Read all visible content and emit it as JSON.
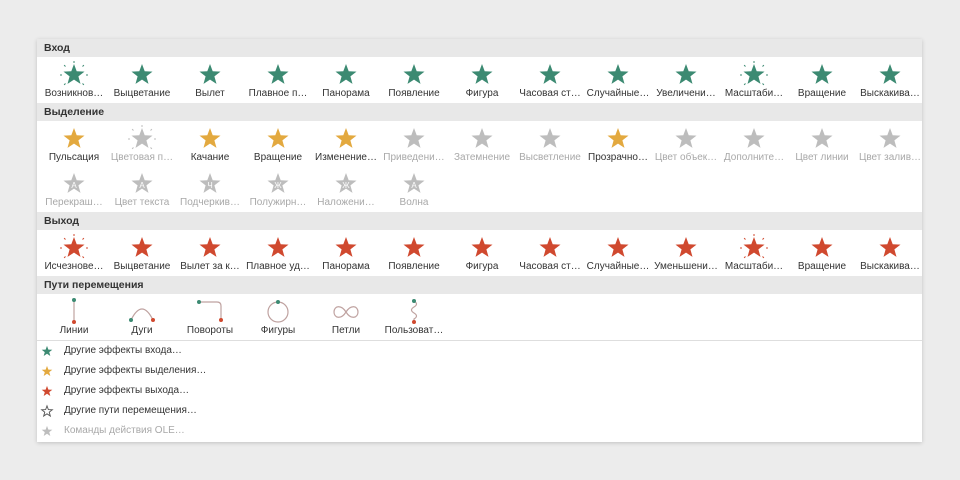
{
  "colors": {
    "entrance": "#3c8a72",
    "emphasis": "#e3a93f",
    "exit": "#d0492f",
    "disabled": "#bdbdbd",
    "path": "#bfa2a0"
  },
  "sections": {
    "entrance": {
      "title": "Вход",
      "items": [
        {
          "label": "Возникнов…",
          "icon": "appear-icon"
        },
        {
          "label": "Выцветание",
          "icon": "fade-icon"
        },
        {
          "label": "Вылет",
          "icon": "fly-in-icon"
        },
        {
          "label": "Плавное п…",
          "icon": "float-in-icon"
        },
        {
          "label": "Панорама",
          "icon": "split-icon"
        },
        {
          "label": "Появление",
          "icon": "wipe-icon"
        },
        {
          "label": "Фигура",
          "icon": "shape-icon"
        },
        {
          "label": "Часовая ст…",
          "icon": "wheel-icon"
        },
        {
          "label": "Случайные…",
          "icon": "random-bars-icon"
        },
        {
          "label": "Увеличени…",
          "icon": "grow-turn-icon"
        },
        {
          "label": "Масштаби…",
          "icon": "zoom-icon"
        },
        {
          "label": "Вращение",
          "icon": "swivel-icon"
        },
        {
          "label": "Выскакива…",
          "icon": "bounce-icon"
        }
      ]
    },
    "emphasis": {
      "title": "Выделение",
      "items": [
        {
          "label": "Пульсация",
          "icon": "pulse-icon",
          "disabled": false
        },
        {
          "label": "Цветовая п…",
          "icon": "color-pulse-icon",
          "disabled": true
        },
        {
          "label": "Качание",
          "icon": "teeter-icon",
          "disabled": false
        },
        {
          "label": "Вращение",
          "icon": "spin-icon",
          "disabled": false
        },
        {
          "label": "Изменение…",
          "icon": "grow-shrink-icon",
          "disabled": false
        },
        {
          "label": "Приведени…",
          "icon": "desaturate-icon",
          "disabled": true
        },
        {
          "label": "Затемнение",
          "icon": "darken-icon",
          "disabled": true
        },
        {
          "label": "Высветление",
          "icon": "lighten-icon",
          "disabled": true
        },
        {
          "label": "Прозрачно…",
          "icon": "transparency-icon",
          "disabled": false
        },
        {
          "label": "Цвет объек…",
          "icon": "object-color-icon",
          "disabled": true
        },
        {
          "label": "Дополните…",
          "icon": "complementary-color-icon",
          "disabled": true
        },
        {
          "label": "Цвет линии",
          "icon": "line-color-icon",
          "disabled": true
        },
        {
          "label": "Цвет залив…",
          "icon": "fill-color-icon",
          "disabled": true
        },
        {
          "label": "Перекраш…",
          "icon": "brush-color-icon",
          "disabled": true,
          "glyph": "A"
        },
        {
          "label": "Цвет текста",
          "icon": "font-color-icon",
          "disabled": true,
          "glyph": "A"
        },
        {
          "label": "Подчеркив…",
          "icon": "underline-icon",
          "disabled": true,
          "glyph": "Ч"
        },
        {
          "label": "Полужирн…",
          "icon": "bold-flash-icon",
          "disabled": true,
          "glyph": "Ж"
        },
        {
          "label": "Наложени…",
          "icon": "bold-reveal-icon",
          "disabled": true,
          "glyph": "Ж"
        },
        {
          "label": "Волна",
          "icon": "wave-icon",
          "disabled": true,
          "glyph": "A"
        }
      ]
    },
    "exit": {
      "title": "Выход",
      "items": [
        {
          "label": "Исчезнове…",
          "icon": "disappear-icon"
        },
        {
          "label": "Выцветание",
          "icon": "fade-out-icon"
        },
        {
          "label": "Вылет за к…",
          "icon": "fly-out-icon"
        },
        {
          "label": "Плавное уд…",
          "icon": "float-out-icon"
        },
        {
          "label": "Панорама",
          "icon": "split-out-icon"
        },
        {
          "label": "Появление",
          "icon": "wipe-out-icon"
        },
        {
          "label": "Фигура",
          "icon": "shape-out-icon"
        },
        {
          "label": "Часовая ст…",
          "icon": "wheel-out-icon"
        },
        {
          "label": "Случайные…",
          "icon": "random-bars-out-icon"
        },
        {
          "label": "Уменьшени…",
          "icon": "shrink-turn-icon"
        },
        {
          "label": "Масштаби…",
          "icon": "zoom-out-icon"
        },
        {
          "label": "Вращение",
          "icon": "swivel-out-icon"
        },
        {
          "label": "Выскакива…",
          "icon": "bounce-out-icon"
        }
      ]
    },
    "motion": {
      "title": "Пути перемещения",
      "items": [
        {
          "label": "Линии",
          "icon": "lines-path-icon"
        },
        {
          "label": "Дуги",
          "icon": "arcs-path-icon"
        },
        {
          "label": "Повороты",
          "icon": "turns-path-icon"
        },
        {
          "label": "Фигуры",
          "icon": "shapes-path-icon"
        },
        {
          "label": "Петли",
          "icon": "loops-path-icon"
        },
        {
          "label": "Пользоват…",
          "icon": "custom-path-icon"
        }
      ]
    }
  },
  "commands": [
    {
      "label": "Другие эффекты входа…",
      "icon": "entrance-star-icon",
      "disabled": false
    },
    {
      "label": "Другие эффекты выделения…",
      "icon": "emphasis-star-icon",
      "disabled": false
    },
    {
      "label": "Другие эффекты выхода…",
      "icon": "exit-star-icon",
      "disabled": false
    },
    {
      "label": "Другие пути перемещения…",
      "icon": "motion-star-icon",
      "disabled": false
    },
    {
      "label": "Команды действия OLE…",
      "icon": "ole-action-icon",
      "disabled": true
    }
  ]
}
